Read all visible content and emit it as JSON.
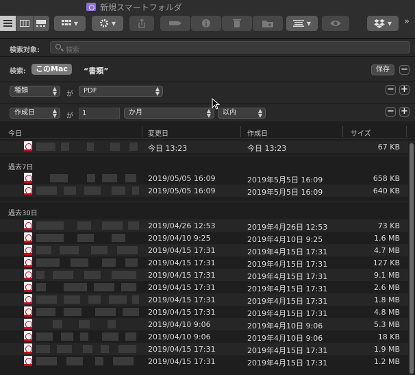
{
  "window": {
    "title": "新規スマートフォルダ"
  },
  "search": {
    "label": "検索対象:",
    "placeholder": "検索"
  },
  "scope": {
    "label": "検索:",
    "this_mac": "このMac",
    "documents": "“書類”",
    "save": "保存"
  },
  "rules": [
    {
      "attr": "種類",
      "ga": "が",
      "value": "PDF"
    },
    {
      "attr": "作成日",
      "ga": "が",
      "number": "1",
      "unit": "か月",
      "cond": "以内"
    }
  ],
  "columns": {
    "name": "今日",
    "modified": "変更日",
    "created": "作成日",
    "size": "サイズ"
  },
  "groups": {
    "week": "過去7日",
    "month": "過去30日"
  },
  "rows_today": [
    {
      "modified": "今日 13:23",
      "created": "今日 13:23",
      "size": "67 KB"
    }
  ],
  "rows_week": [
    {
      "modified": "2019/05/05 16:09",
      "created": "2019年5月5日 16:09",
      "size": "658 KB"
    },
    {
      "modified": "2019/05/05 16:09",
      "created": "2019年5月5日 16:09",
      "size": "640 KB"
    }
  ],
  "rows_month": [
    {
      "modified": "2019/04/26 12:53",
      "created": "2019年4月26日 12:53",
      "size": "73 KB"
    },
    {
      "modified": "2019/04/10 9:25",
      "created": "2019年4月10日 9:25",
      "size": "1.6 MB"
    },
    {
      "modified": "2019/04/15 17:31",
      "created": "2019年4月15日 17:31",
      "size": "4.7 MB"
    },
    {
      "modified": "2019/04/15 17:31",
      "created": "2019年4月15日 17:31",
      "size": "127 KB"
    },
    {
      "modified": "2019/04/15 17:31",
      "created": "2019年4月15日 17:31",
      "size": "9.1 MB"
    },
    {
      "modified": "2019/04/15 17:31",
      "created": "2019年4月15日 17:31",
      "size": "2.6 MB"
    },
    {
      "modified": "2019/04/15 17:31",
      "created": "2019年4月15日 17:31",
      "size": "1.8 MB"
    },
    {
      "modified": "2019/04/15 17:31",
      "created": "2019年4月15日 17:31",
      "size": "4.8 MB"
    },
    {
      "modified": "2019/04/10 9:06",
      "created": "2019年4月10日 9:06",
      "size": "5.3 MB"
    },
    {
      "modified": "2019/04/10 9:06",
      "created": "2019年4月10日 9:06",
      "size": "18 KB"
    },
    {
      "modified": "2019/04/15 17:31",
      "created": "2019年4月15日 17:31",
      "size": "1.9 MB"
    },
    {
      "modified": "2019/04/15 17:31",
      "created": "2019年4月15日 17:31",
      "size": "1.2 MB"
    }
  ],
  "toolbar": {
    "icons": [
      "list-view-icon",
      "column-view-icon",
      "gallery-view-icon",
      "group-by-icon",
      "gear-icon",
      "share-icon",
      "tag-icon",
      "info-icon",
      "trash-icon",
      "new-folder-icon",
      "arrange-icon",
      "quicklook-icon",
      "dropbox-icon",
      "more-icon"
    ],
    "more": "»"
  },
  "colors": {
    "pdf_red": "#d0021b",
    "window_bg": "#1e1e1e",
    "toolbar_bg": "#2e2e2e"
  }
}
